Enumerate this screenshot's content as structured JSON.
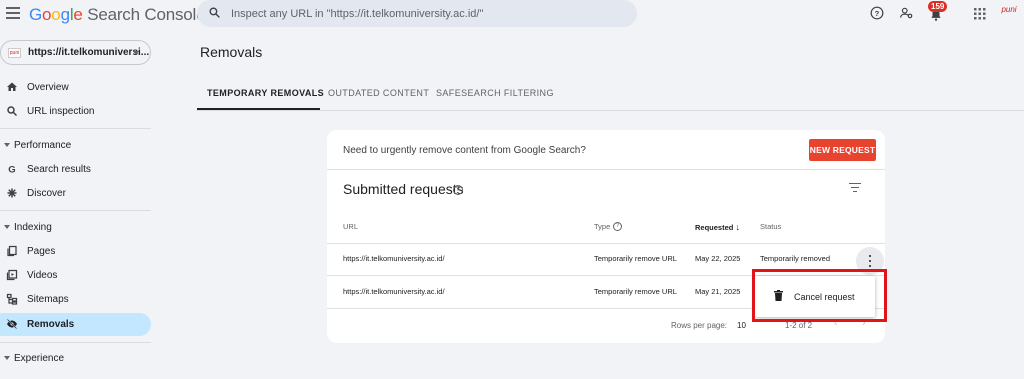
{
  "header": {
    "logo": {
      "g1": "G",
      "o1": "o",
      "o2": "o",
      "g2": "g",
      "l": "l",
      "e": "e",
      "rest": "Search Console"
    },
    "search_placeholder": "Inspect any URL in \"https://it.telkomuniversity.ac.id/\"",
    "notification_count": "159",
    "brand_text": "puni"
  },
  "property": {
    "label": "https://it.telkomuniversi...",
    "favicon_text": "puni"
  },
  "sidebar": {
    "items": [
      {
        "label": "Overview",
        "icon": "home-icon"
      },
      {
        "label": "URL inspection",
        "icon": "search-icon"
      }
    ],
    "performance": {
      "section": "Performance",
      "items": [
        {
          "label": "Search results",
          "icon": "google-g-icon"
        },
        {
          "label": "Discover",
          "icon": "asterisk-icon"
        }
      ]
    },
    "indexing": {
      "section": "Indexing",
      "items": [
        {
          "label": "Pages",
          "icon": "pages-icon"
        },
        {
          "label": "Videos",
          "icon": "video-icon"
        },
        {
          "label": "Sitemaps",
          "icon": "sitemap-icon"
        },
        {
          "label": "Removals",
          "icon": "eye-off-icon",
          "active": true
        }
      ]
    },
    "experience": {
      "section": "Experience"
    }
  },
  "main": {
    "title": "Removals",
    "tabs": [
      "TEMPORARY REMOVALS",
      "OUTDATED CONTENT",
      "SAFESEARCH FILTERING"
    ],
    "notice": "Need to urgently remove content from Google Search?",
    "new_request": "NEW REQUEST",
    "submitted_title": "Submitted requests",
    "help_glyph": "?",
    "columns": {
      "url": "URL",
      "type": "Type",
      "requested": "Requested",
      "status": "Status"
    },
    "sort_arrow": "↓",
    "rows": [
      {
        "url": "https://it.telkomuniversity.ac.id/",
        "type": "Temporarily remove URL",
        "requested": "May 22, 2025",
        "status": "Temporarily removed"
      },
      {
        "url": "https://it.telkomuniversity.ac.id/",
        "type": "Temporarily remove URL",
        "requested": "May 21, 2025",
        "status": ""
      }
    ],
    "footer": {
      "rows_per_page_label": "Rows per page:",
      "rows_per_page_value": "10",
      "range": "1-2 of 2",
      "prev": "‹",
      "next": "›"
    },
    "popup": {
      "cancel_request": "Cancel request"
    }
  },
  "colors": {
    "accent_red": "#e8432f",
    "active_nav": "#c2e7ff",
    "highlight_box": "#e1141a"
  }
}
